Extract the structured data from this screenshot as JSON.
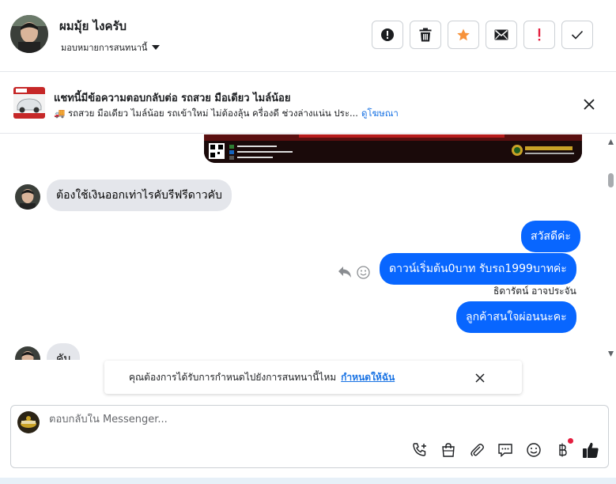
{
  "header": {
    "name": "ผมมุ้ย ไงครับ",
    "assign_label": "มอบหมายการสนทนานี้"
  },
  "toolbar": {
    "buttons": [
      {
        "icon": "alert-circle-icon",
        "color": "#1c1e21"
      },
      {
        "icon": "trash-icon",
        "color": "#1c1e21"
      },
      {
        "icon": "star-icon",
        "color": "#f7923a"
      },
      {
        "icon": "envelope-icon",
        "color": "#1c1e21"
      },
      {
        "icon": "exclamation-icon",
        "color": "#e41e3f"
      },
      {
        "icon": "check-icon",
        "color": "#1c1e21"
      }
    ]
  },
  "ad": {
    "title": "แชทนี้มีข้อความตอบกลับต่อ รถสวย มือเดียว ไมล์น้อย",
    "subtitle": "🚚 รถสวย มือเดียว ไมล์น้อย รถเข้าใหม่ ไม่ต้องลุ้น ครื่องดี ช่วงล่างแน่น ประ...",
    "link": "ดูโฆษณา"
  },
  "messages": {
    "incoming_1": "ต้องใช้เงินออกเท่าไรคับรีฟรีดาวคับ",
    "outgoing_1": "สวัสดีค่ะ",
    "outgoing_2": "ดาวน์เริ่มต้น0บาท รับรถ1999บาทค่ะ",
    "sender_name": "ธิดารัตน์ อาจประจัน",
    "outgoing_3": "ลูกค้าสนใจผ่อนนะคะ",
    "incoming_2": "คับ"
  },
  "notice": {
    "text": "คุณต้องการได้รับการกำหนดไปยังการสนทนานี้ไหม",
    "link": "กำหนดให้ฉัน"
  },
  "composer": {
    "placeholder": "ตอบกลับใน Messenger..."
  },
  "colors": {
    "accent": "#0866ff",
    "link": "#1b74e4",
    "star": "#f7923a",
    "alert": "#e41e3f"
  }
}
